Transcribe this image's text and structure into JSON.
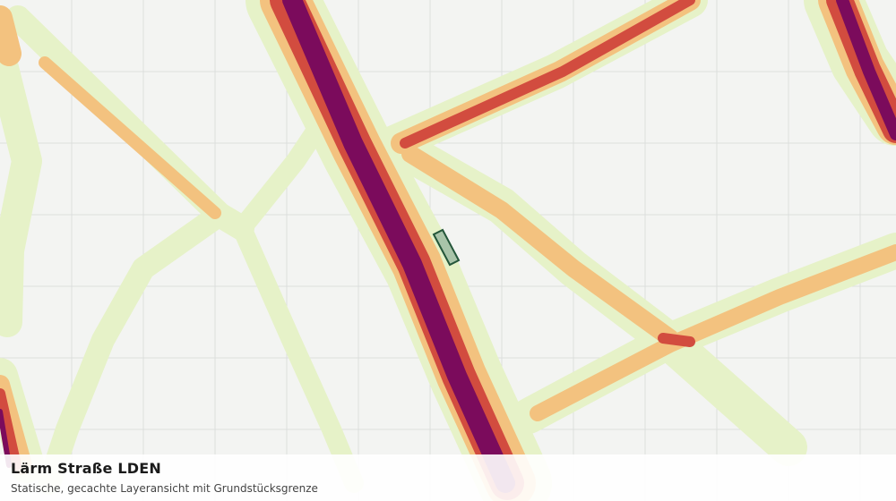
{
  "layer": {
    "title": "Lärm Straße LDEN",
    "subtitle": "Statische, gecachte Layeransicht mit Grundstücksgrenze"
  },
  "colors": {
    "background": "#f3f4f2",
    "grid": "#dcdfdc",
    "noise_band_outer": "#e6f2c8",
    "noise_band_low": "#f3c27f",
    "noise_band_high": "#d24c3f",
    "noise_band_very_high": "#7b0b5c",
    "parcel_fill": "#a9c4a9",
    "parcel_stroke": "#24563a"
  },
  "icons": [
    "parcel-boundary-marker"
  ]
}
